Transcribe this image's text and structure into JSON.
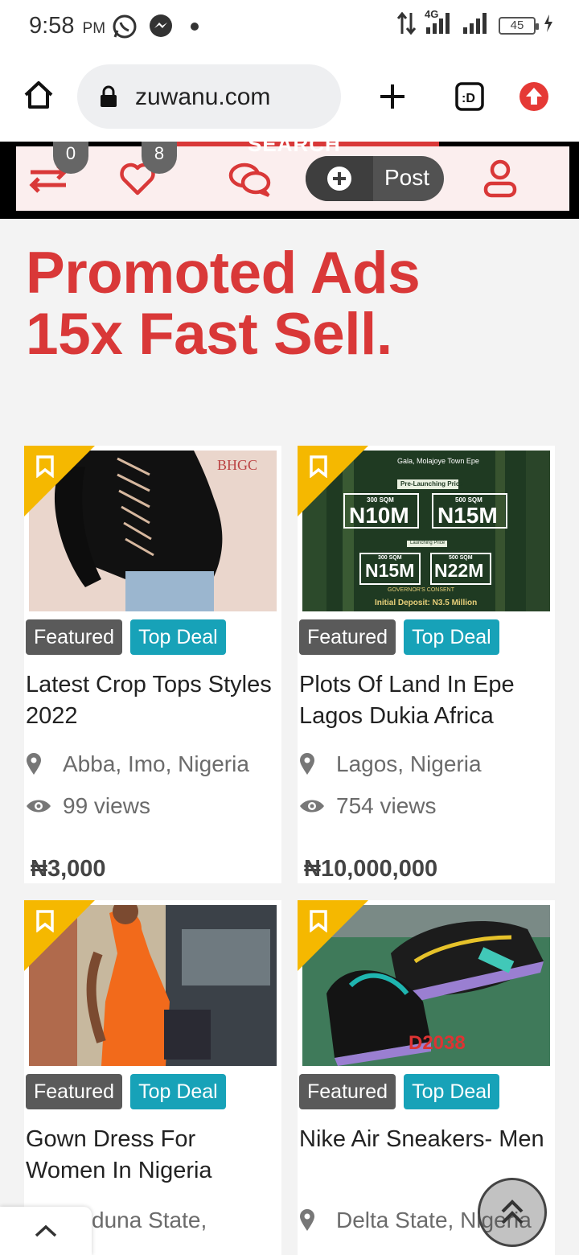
{
  "status_bar": {
    "time": "9:58",
    "ampm": "PM",
    "network": "4G",
    "battery": "45"
  },
  "browser": {
    "url": "zuwanu.com"
  },
  "site_header": {
    "compare_count": "0",
    "wishlist_count": "8",
    "search_label": "SEARCH",
    "post_label": "Post"
  },
  "promo": {
    "line1": "Promoted Ads",
    "line2": "15x Fast Sell."
  },
  "colors": {
    "brand_red": "#d93838",
    "featured": "#5a5a5a",
    "top_deal": "#17a2b8",
    "corner": "#f5b800"
  },
  "listings": [
    {
      "badges": [
        "Featured",
        "Top Deal"
      ],
      "title": "Latest Crop Tops Styles 2022",
      "location": "Abba, Imo, Nigeria",
      "views": "99 views",
      "price": "₦3,000",
      "image_label": "BHGC"
    },
    {
      "badges": [
        "Featured",
        "Top Deal"
      ],
      "title": "Plots Of Land In Epe Lagos Dukia Africa",
      "location": "Lagos, Nigeria",
      "views": "754 views",
      "price": "₦10,000,000",
      "image_text": {
        "address": "Gala, Molajoye Town Epe",
        "prelaunch": "Pre-Launching Price",
        "p1_size": "300 SQM",
        "p1": "N10M",
        "p2_size": "500 SQM",
        "p2": "N15M",
        "launching": "Launching Price",
        "p3_size": "300 SQM",
        "p3": "N15M",
        "p4_size": "500 SQM",
        "p4": "N22M",
        "consent": "GOVERNOR'S CONSENT",
        "deposit": "Initial Deposit: N3.5 Million"
      }
    },
    {
      "badges": [
        "Featured",
        "Top Deal"
      ],
      "title": "Gown Dress For Women In Nigeria",
      "location": "duna State,"
    },
    {
      "badges": [
        "Featured",
        "Top Deal"
      ],
      "title": "Nike Air Sneakers- Men",
      "location": "Delta State, Nigeria",
      "image_label": "D2038"
    }
  ]
}
